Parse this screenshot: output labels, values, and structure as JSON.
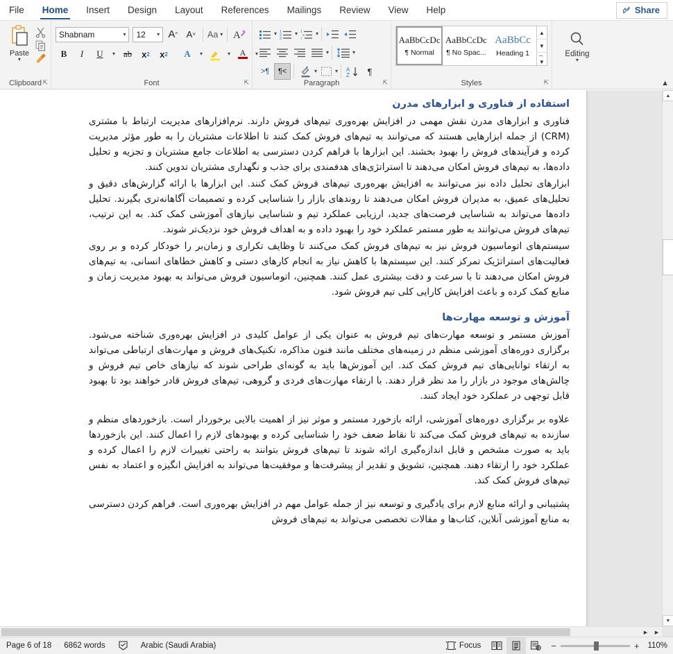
{
  "window": {
    "tabs": [
      {
        "id": "file",
        "label": "File",
        "active": false
      },
      {
        "id": "home",
        "label": "Home",
        "active": true
      },
      {
        "id": "insert",
        "label": "Insert",
        "active": false
      },
      {
        "id": "design",
        "label": "Design",
        "active": false
      },
      {
        "id": "layout",
        "label": "Layout",
        "active": false
      },
      {
        "id": "references",
        "label": "References",
        "active": false
      },
      {
        "id": "mailings",
        "label": "Mailings",
        "active": false
      },
      {
        "id": "review",
        "label": "Review",
        "active": false
      },
      {
        "id": "view",
        "label": "View",
        "active": false
      },
      {
        "id": "help",
        "label": "Help",
        "active": false
      }
    ],
    "share_label": "Share",
    "share_icon": "share-icon",
    "accent_color": "#2b579a"
  },
  "ribbon": {
    "collapse_icon": "chevron-up-icon",
    "groups": {
      "clipboard": {
        "label": "Clipboard",
        "paste_label": "Paste",
        "paste_icon": "paste-icon",
        "paste_caret": "chevron-down-icon",
        "cut_icon": "scissors-icon",
        "copy_icon": "copy-icon",
        "format_painter_icon": "format-painter-icon",
        "dialog_launcher": "dialog-launcher-icon"
      },
      "font": {
        "label": "Font",
        "font_name": "Shabnam",
        "font_size": "12",
        "grow_font_icon": "grow-font-icon",
        "shrink_font_icon": "shrink-font-icon",
        "change_case_icon": "change-case-icon",
        "clear_formatting_icon": "clear-formatting-icon",
        "bold_icon": "bold-icon",
        "italic_icon": "italic-icon",
        "underline_icon": "underline-icon",
        "strikethrough_icon": "strikethrough-icon",
        "subscript_icon": "subscript-icon",
        "superscript_icon": "superscript-icon",
        "text_effects_icon": "text-effects-icon",
        "highlight_icon": "text-highlight-icon",
        "font_color_icon": "font-color-icon",
        "dialog_launcher": "dialog-launcher-icon",
        "bold_label": "B",
        "italic_label": "I",
        "underline_label": "U",
        "strike_label": "ab",
        "sub_label": "x",
        "super_label": "x",
        "case_label": "Aa",
        "grow_label": "A",
        "shrink_label": "A",
        "effects_label": "A",
        "highlight_label": "A",
        "color_label": "A"
      },
      "paragraph": {
        "label": "Paragraph",
        "bullets_icon": "bullet-list-icon",
        "numbering_icon": "numbered-list-icon",
        "multilevel_icon": "multilevel-list-icon",
        "decrease_indent_icon": "decrease-indent-icon",
        "increase_indent_icon": "increase-indent-icon",
        "align_left_icon": "align-left-icon",
        "align_center_icon": "align-center-icon",
        "align_right_icon": "align-right-icon",
        "justify_icon": "justify-icon",
        "line_spacing_icon": "line-spacing-icon",
        "ltr_icon": "left-to-right-text-icon",
        "rtl_icon": "right-to-left-text-icon",
        "shading_icon": "shading-icon",
        "borders_icon": "borders-icon",
        "sort_icon": "sort-icon",
        "show_marks_icon": "show-formatting-marks-icon",
        "dialog_launcher": "dialog-launcher-icon",
        "rtl_active": true
      },
      "styles": {
        "label": "Styles",
        "dialog_launcher": "dialog-launcher-icon",
        "scroll_up_icon": "chevron-up-icon",
        "scroll_down_icon": "chevron-down-icon",
        "more_icon": "gallery-more-icon",
        "items": [
          {
            "preview": "AaBbCcDc",
            "name": "¶ Normal",
            "selected": true,
            "blue": false
          },
          {
            "preview": "AaBbCcDc",
            "name": "¶ No Spac...",
            "selected": false,
            "blue": false
          },
          {
            "preview": "AaBbCc",
            "name": "Heading 1",
            "selected": false,
            "blue": true
          }
        ]
      },
      "editing": {
        "label": "Editing",
        "icon": "search-icon",
        "caret": "chevron-down-icon"
      }
    }
  },
  "document": {
    "language_direction": "rtl",
    "heading_color": "#2f5496",
    "blocks": [
      {
        "type": "heading",
        "id": "heading-technology",
        "text": "استفاده از فناوری و ابزارهای مدرن"
      },
      {
        "type": "paragraph",
        "id": "para-technology-1",
        "text": "فناوری و ابزارهای مدرن نقش مهمی در افزایش بهره‌وری تیم‌های فروش دارند. نرم‌افزارهای مدیریت ارتباط با مشتری (CRM) از جمله ابزارهایی هستند که می‌توانند به تیم‌های فروش کمک کنند تا اطلاعات مشتریان را به طور مؤثر مدیریت کرده و فرآیندهای فروش را بهبود بخشند. این ابزارها با فراهم کردن دسترسی به اطلاعات جامع مشتریان و تجزیه و تحلیل داده‌ها، به تیم‌های فروش امکان می‌دهند تا استراتژی‌های هدفمندی برای جذب و نگهداری مشتریان تدوین کنند."
      },
      {
        "type": "paragraph",
        "id": "para-technology-2",
        "text": "ابزارهای تحلیل داده نیز می‌توانند به افزایش بهره‌وری تیم‌های فروش کمک کنند. این ابزارها با ارائه گزارش‌های دقیق و تحلیل‌های عمیق، به مدیران فروش امکان می‌دهند تا روندهای بازار را شناسایی کرده و تصمیمات آگاهانه‌تری بگیرند. تحلیل داده‌ها می‌تواند به شناسایی فرصت‌های جدید، ارزیابی عملکرد تیم و شناسایی نیازهای آموزشی کمک کند. به این ترتیب، تیم‌های فروش می‌توانند به طور مستمر عملکرد خود را بهبود داده و به اهداف فروش خود نزدیک‌تر شوند."
      },
      {
        "type": "paragraph",
        "id": "para-technology-3",
        "text": "سیستم‌های اتوماسیون فروش نیز به تیم‌های فروش کمک می‌کنند تا وظایف تکراری و زمان‌بر را خودکار کرده و بر روی فعالیت‌های استراتژیک تمرکز کنند. این سیستم‌ها با کاهش نیاز به انجام کارهای دستی و کاهش خطاهای انسانی، به تیم‌های فروش امکان می‌دهند تا با سرعت و دقت بیشتری عمل کنند. همچنین، اتوماسیون فروش می‌تواند به بهبود مدیریت زمان و منابع کمک کرده و باعث افزایش کارایی کلی تیم فروش شود."
      },
      {
        "type": "heading",
        "id": "heading-training",
        "text": "آموزش و توسعه مهارت‌ها"
      },
      {
        "type": "paragraph",
        "id": "para-training-1",
        "text": "آموزش مستمر و توسعه مهارت‌های تیم فروش به عنوان یکی از عوامل کلیدی در افزایش بهره‌وری شناخته می‌شود. برگزاری دوره‌های آموزشی منظم در زمینه‌های مختلف مانند فنون مذاکره، تکنیک‌های فروش و مهارت‌های ارتباطی می‌تواند به ارتقاء توانایی‌های تیم فروش کمک کند. این آموزش‌ها باید به گونه‌ای طراحی شوند که نیازهای خاص تیم فروش و چالش‌های موجود در بازار را مد نظر قرار دهند. با ارتقاء مهارت‌های فردی و گروهی، تیم‌های فروش قادر خواهند بود تا بهبود قابل توجهی در عملکرد خود ایجاد کنند."
      },
      {
        "type": "paragraph",
        "id": "para-training-2",
        "text": "علاوه بر برگزاری دوره‌های آموزشی، ارائه بازخورد مستمر و موثر نیز از اهمیت بالایی برخوردار است. بازخوردهای منظم و سازنده به تیم‌های فروش کمک می‌کند تا نقاط ضعف خود را شناسایی کرده و بهبودهای لازم را اعمال کنند. این بازخوردها باید به صورت مشخص و قابل اندازه‌گیری ارائه شوند تا تیم‌های فروش بتوانند به راحتی تغییرات لازم را اعمال کرده و عملکرد خود را ارتقاء دهند. همچنین، تشویق و تقدیر از پیشرفت‌ها و موفقیت‌ها می‌تواند به افزایش انگیزه و اعتماد به نفس تیم‌های فروش کمک کند."
      },
      {
        "type": "paragraph",
        "id": "para-training-3",
        "text": "پشتیبانی و ارائه منابع لازم برای یادگیری و توسعه نیز از جمله عوامل مهم در افزایش بهره‌وری است. فراهم کردن دسترسی به منابع آموزشی آنلاین، کتاب‌ها و مقالات تخصصی می‌تواند به تیم‌های فروش"
      }
    ]
  },
  "statusbar": {
    "page_label": "Page 6 of 18",
    "word_count": "6862 words",
    "proofing_icon": "proofing-errors-icon",
    "language": "Arabic (Saudi Arabia)",
    "focus_label": "Focus",
    "focus_icon": "focus-mode-icon",
    "view_read_icon": "read-mode-icon",
    "view_print_icon": "print-layout-icon",
    "view_web_icon": "web-layout-icon",
    "zoom_out_label": "−",
    "zoom_in_label": "+",
    "zoom_value": "110%"
  },
  "scrollbars": {
    "vertical_up_icon": "scroll-up-icon",
    "vertical_down_icon": "scroll-down-icon",
    "horizontal_left_icon": "scroll-left-icon",
    "horizontal_right_icon": "scroll-right-icon"
  }
}
